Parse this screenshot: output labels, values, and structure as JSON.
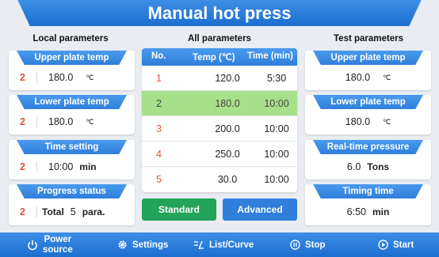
{
  "app": {
    "title": "Manual hot press"
  },
  "local": {
    "title": "Local parameters",
    "upper": {
      "label": "Upper plate temp",
      "index": "2",
      "value": "180.0",
      "unit": "℃"
    },
    "lower": {
      "label": "Lower plate temp",
      "index": "2",
      "value": "180.0",
      "unit": "℃"
    },
    "time": {
      "label": "Time setting",
      "index": "2",
      "value": "10:00",
      "unit": "min"
    },
    "progress": {
      "label": "Progress status",
      "index": "2",
      "total_label": "Total",
      "value": "5",
      "unit": "para."
    }
  },
  "all": {
    "title": "All parameters",
    "headers": {
      "no": "No.",
      "temp": "Temp (℃)",
      "time": "Time (min)"
    },
    "rows": [
      {
        "no": "1",
        "temp": "120.0",
        "time": "5:30"
      },
      {
        "no": "2",
        "temp": "180.0",
        "time": "10:00"
      },
      {
        "no": "3",
        "temp": "200.0",
        "time": "10:00"
      },
      {
        "no": "4",
        "temp": "250.0",
        "time": "10:00"
      },
      {
        "no": "5",
        "temp": "30.0",
        "time": "10:00"
      }
    ],
    "selected_row": 2,
    "standard_label": "Standard",
    "advanced_label": "Advanced"
  },
  "test": {
    "title": "Test parameters",
    "upper": {
      "label": "Upper plate temp",
      "value": "180.0",
      "unit": "℃"
    },
    "lower": {
      "label": "Lower plate temp",
      "value": "180.0",
      "unit": "℃"
    },
    "pressure": {
      "label": "Real-time pressure",
      "value": "6.0",
      "unit": "Tons"
    },
    "timing": {
      "label": "Timing time",
      "value": "6:50",
      "unit": "min"
    }
  },
  "bottom": {
    "power_line1": "Power",
    "power_line2": "source",
    "settings": "Settings",
    "list_curve": "List/Curve",
    "stop": "Stop",
    "start": "Start"
  },
  "colors": {
    "accent": "#2f7fdb",
    "index_red": "#e0543a",
    "selected_row": "#a8df8a",
    "standard_green": "#22a45a"
  },
  "icons": [
    "power-icon",
    "gear-icon",
    "list-curve-icon",
    "stop-icon",
    "start-icon"
  ]
}
